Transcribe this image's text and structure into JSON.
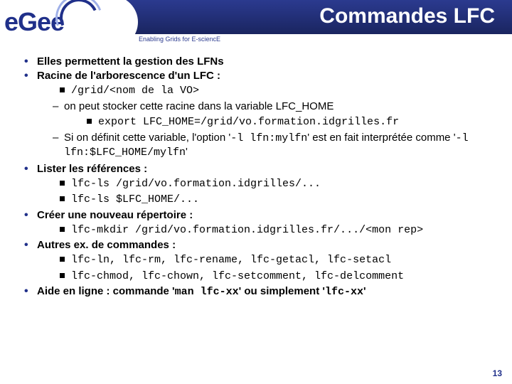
{
  "header": {
    "logo_text": "eGee",
    "tagline": "Enabling Grids for E-sciencE",
    "title": "Commandes LFC"
  },
  "b1": {
    "l1": "Elles permettent la gestion des LFNs",
    "l2": "Racine de l'arborescence d'un LFC :",
    "code": "/grid/<nom de la VO>",
    "d1": "on peut stocker cette racine dans la variable LFC_HOME",
    "d1code": "export LFC_HOME=/grid/vo.formation.idgrilles.fr",
    "d2a": "Si on définit cette variable, l'option '",
    "d2code1": "-l lfn:mylfn",
    "d2b": "' est en fait interprétée comme '",
    "d2code2": "-l lfn:$LFC_HOME/mylfn",
    "d2c": "'"
  },
  "b2": {
    "title": "Lister les références :",
    "c1": "lfc-ls /grid/vo.formation.idgrilles/...",
    "c2": "lfc-ls $LFC_HOME/..."
  },
  "b3": {
    "title": "Créer une nouveau répertoire :",
    "c1": "lfc-mkdir /grid/vo.formation.idgrilles.fr/.../<mon rep>"
  },
  "b4": {
    "title": "Autres ex. de commandes :",
    "c1": "lfc-ln, lfc-rm, lfc-rename, lfc-getacl, lfc-setacl",
    "c2": "lfc-chmod, lfc-chown, lfc-setcomment, lfc-delcomment"
  },
  "b5": {
    "pre": "Aide en ligne : commande '",
    "code1": "man lfc-xx",
    "mid": "' ou simplement '",
    "code2": "lfc-xx",
    "post": "'"
  },
  "slide_number": "13"
}
